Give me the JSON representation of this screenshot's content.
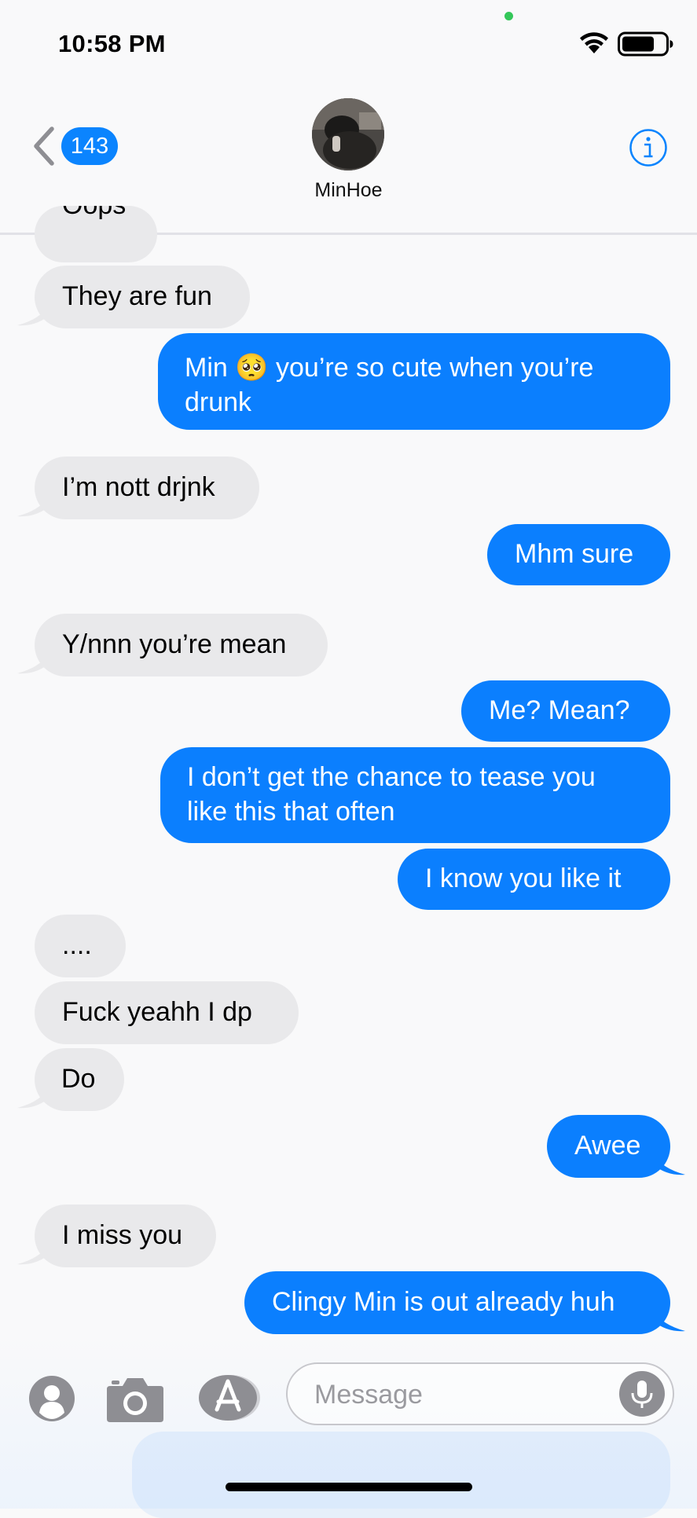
{
  "status_bar": {
    "time": "10:58 PM"
  },
  "nav": {
    "unread_count": "143",
    "contact_name": "MinHoe",
    "info_label": "i"
  },
  "messages": {
    "m0": "Oops",
    "m1": "They are fun",
    "m2_line1": "Min 🥺 you’re so cute when you’re",
    "m2_line2": "drunk",
    "m3": "I’m nott drjnk",
    "m4": "Mhm sure",
    "m5": "Y/nnn you’re mean",
    "m6": "Me? Mean?",
    "m7_line1": "I don’t get the chance to tease you",
    "m7_line2": "like this that often",
    "m8": "I know you like it",
    "m9": "....",
    "m10": "Fuck yeahh I dp",
    "m11": "Do",
    "m12": "Awee",
    "m13": "I miss you",
    "m14": "Clingy Min is out already huh"
  },
  "input": {
    "placeholder": "Message"
  },
  "colors": {
    "outgoing": "#0b7ffe",
    "incoming": "#e9e9eb",
    "accent": "#0b84fe"
  },
  "icons": [
    "back-chevron-icon",
    "info-icon",
    "wifi-icon",
    "battery-icon",
    "contacts-app-icon",
    "camera-icon",
    "app-store-icon",
    "microphone-icon"
  ]
}
